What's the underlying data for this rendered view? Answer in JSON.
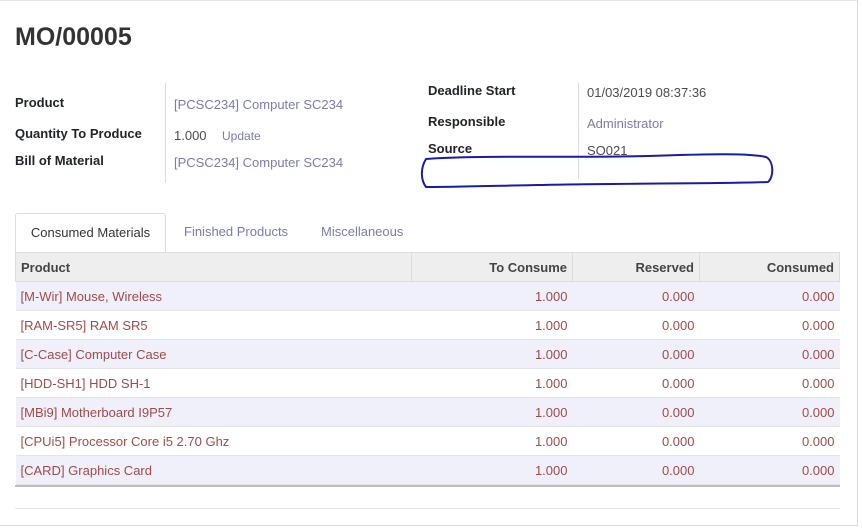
{
  "record": {
    "title": "MO/00005"
  },
  "left_fields": {
    "product_label": "Product",
    "product_value": "[PCSC234] Computer SC234",
    "qty_label": "Quantity To Produce",
    "qty_value": "1.000",
    "update_label": "Update",
    "bom_label": "Bill of Material",
    "bom_value": "[PCSC234] Computer SC234"
  },
  "right_fields": {
    "deadline_label": "Deadline Start",
    "deadline_value": "01/03/2019 08:37:36",
    "responsible_label": "Responsible",
    "responsible_value": "Administrator",
    "source_label": "Source",
    "source_value": "SO021"
  },
  "tabs": [
    {
      "label": "Consumed Materials",
      "active": true
    },
    {
      "label": "Finished Products",
      "active": false
    },
    {
      "label": "Miscellaneous",
      "active": false
    }
  ],
  "table": {
    "headers": [
      "Product",
      "To Consume",
      "Reserved",
      "Consumed"
    ],
    "rows": [
      [
        "[M-Wir] Mouse, Wireless",
        "1.000",
        "0.000",
        "0.000"
      ],
      [
        "[RAM-SR5] RAM SR5",
        "1.000",
        "0.000",
        "0.000"
      ],
      [
        "[C-Case] Computer Case",
        "1.000",
        "0.000",
        "0.000"
      ],
      [
        "[HDD-SH1] HDD SH-1",
        "1.000",
        "0.000",
        "0.000"
      ],
      [
        "[MBi9] Motherboard I9P57",
        "1.000",
        "0.000",
        "0.000"
      ],
      [
        "[CPUi5] Processor Core i5 2.70 Ghz",
        "1.000",
        "0.000",
        "0.000"
      ],
      [
        "[CARD] Graphics Card",
        "1.000",
        "0.000",
        "0.000"
      ]
    ]
  },
  "colors": {
    "link": "#7c7bad",
    "row_text": "#a24a4a",
    "row_stripe": "#eff0f9",
    "scribble": "#1a1aa8"
  }
}
